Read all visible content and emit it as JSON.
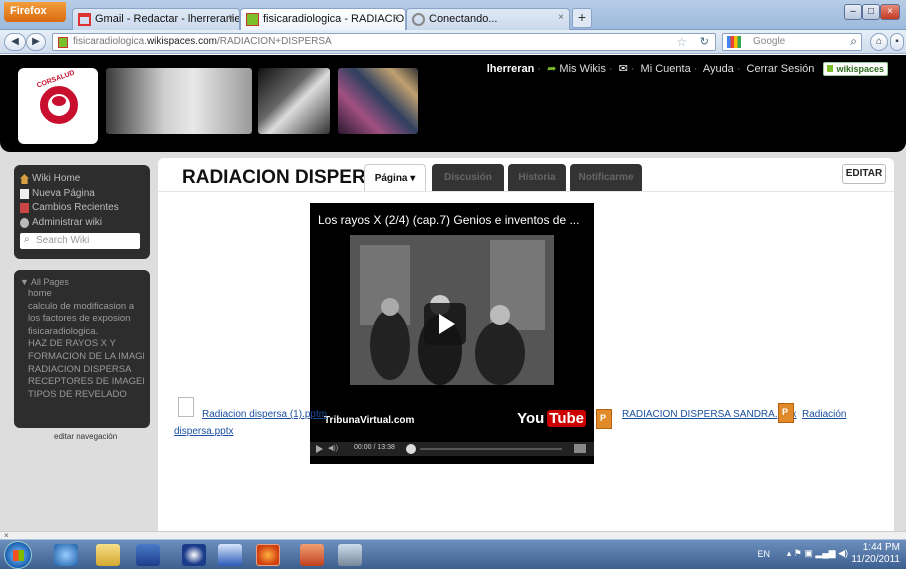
{
  "browser": {
    "app_button": "Firefox",
    "tabs": [
      {
        "label": "Gmail - Redactar - lherreranieves@g...",
        "active": false
      },
      {
        "label": "fisicaradiologica - RADIACION DISPE...",
        "active": true
      },
      {
        "label": "Conectando...",
        "active": false
      }
    ],
    "url_domain_prefix": "fisicaradiologica.",
    "url_domain": "wikispaces.com",
    "url_path": "/RADIACION+DISPERSA",
    "search_placeholder": "Google"
  },
  "header": {
    "logo_text": "CORSALUD",
    "user": "lherreran",
    "links": [
      "Mis Wikis",
      "Mi Cuenta",
      "Ayuda",
      "Cerrar Sesión"
    ],
    "badge": "wikispaces"
  },
  "sidebar": {
    "items": [
      {
        "label": "Wiki Home",
        "icon": "home-icon"
      },
      {
        "label": "Nueva Página",
        "icon": "new-page-icon"
      },
      {
        "label": "Cambios Recientes",
        "icon": "calendar-icon"
      },
      {
        "label": "Administrar wiki",
        "icon": "gear-icon"
      }
    ],
    "search_placeholder": "Search Wiki",
    "pages_header": "▼ All Pages",
    "pages": [
      "home",
      "calculo de modificasion a",
      "los factores de exposion",
      "fisicaradiologica.",
      "HAZ DE RAYOS X Y",
      "FORMACION DE LA IMAGEN",
      "RADIACION DISPERSA",
      "RECEPTORES DE IMAGEN",
      "TIPOS DE REVELADO"
    ],
    "edit_nav": "editar navegación"
  },
  "main": {
    "title": "RADIACION DISPERSA",
    "tabs": [
      "Página ▾",
      "Discusión",
      "Historia",
      "Notificarme"
    ],
    "edit_button": "EDITAR",
    "video": {
      "title": "Los rayos X (2/4) (cap.7) Genios e inventos de ...",
      "channel": "TribunaVirtual.com",
      "brand_you": "You",
      "brand_tube": "Tube",
      "time": "00:00 / 13:38"
    },
    "files": {
      "file1": "Radiacion dispersa (1).pptm",
      "file2": "RADIACION DISPERSA SANDRA.pptx",
      "file3_a": "Radiación",
      "file3_b": "dispersa.pptx"
    }
  },
  "status": {
    "close": "×"
  },
  "taskbar": {
    "lang": "EN",
    "time": "1:44 PM",
    "date": "11/20/2011"
  }
}
